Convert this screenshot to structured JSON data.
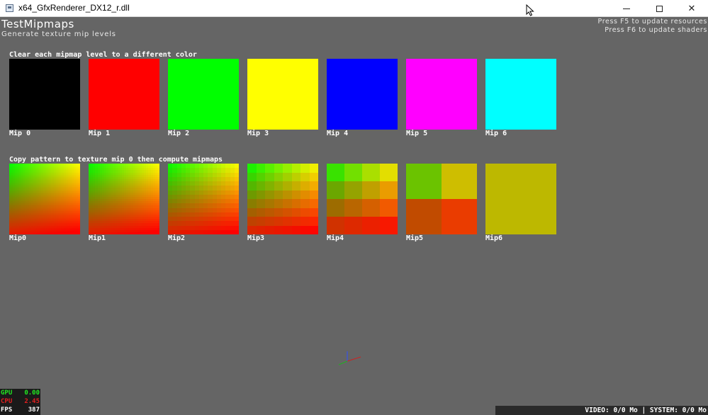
{
  "window": {
    "title": "x64_GfxRenderer_DX12_r.dll",
    "minimize_glyph": "",
    "close_glyph": "✕"
  },
  "app": {
    "name": "TestMipmaps",
    "subtitle": "Generate texture mip levels"
  },
  "hints": {
    "resources": "Press F5 to update resources",
    "shaders": "Press F6 to update shaders"
  },
  "section_clear": {
    "label": "Clear each mipmap level to a different color",
    "mips": [
      {
        "label": "Mip 0",
        "color": "#000000"
      },
      {
        "label": "Mip 1",
        "color": "#ff0000"
      },
      {
        "label": "Mip 2",
        "color": "#00ff00"
      },
      {
        "label": "Mip 3",
        "color": "#ffff00"
      },
      {
        "label": "Mip 4",
        "color": "#0000ff"
      },
      {
        "label": "Mip 5",
        "color": "#ff00ff"
      },
      {
        "label": "Mip 6",
        "color": "#00ffff"
      }
    ]
  },
  "section_compute": {
    "label": "Copy pattern to texture mip 0 then compute mipmaps",
    "mips": [
      {
        "label": "Mip0",
        "cells": 64
      },
      {
        "label": "Mip1",
        "cells": 32
      },
      {
        "label": "Mip2",
        "cells": 16
      },
      {
        "label": "Mip3",
        "cells": 8
      },
      {
        "label": "Mip4",
        "cells": 4
      },
      {
        "label": "Mip5",
        "cells": 2
      },
      {
        "label": "Mip6",
        "cells": 1
      }
    ],
    "mip6_color": "#bdb800"
  },
  "stats": {
    "gpu_label": "GPU",
    "gpu_value": "0.00",
    "cpu_label": "CPU",
    "cpu_value": "2.45",
    "fps_label": "FPS",
    "fps_value": "387"
  },
  "memory": {
    "text": "VIDEO: 0/0 Mo | SYSTEM: 0/0 Mo"
  },
  "colors": {
    "background": "#656565",
    "gpu": "#22e822",
    "cpu": "#e02020"
  }
}
